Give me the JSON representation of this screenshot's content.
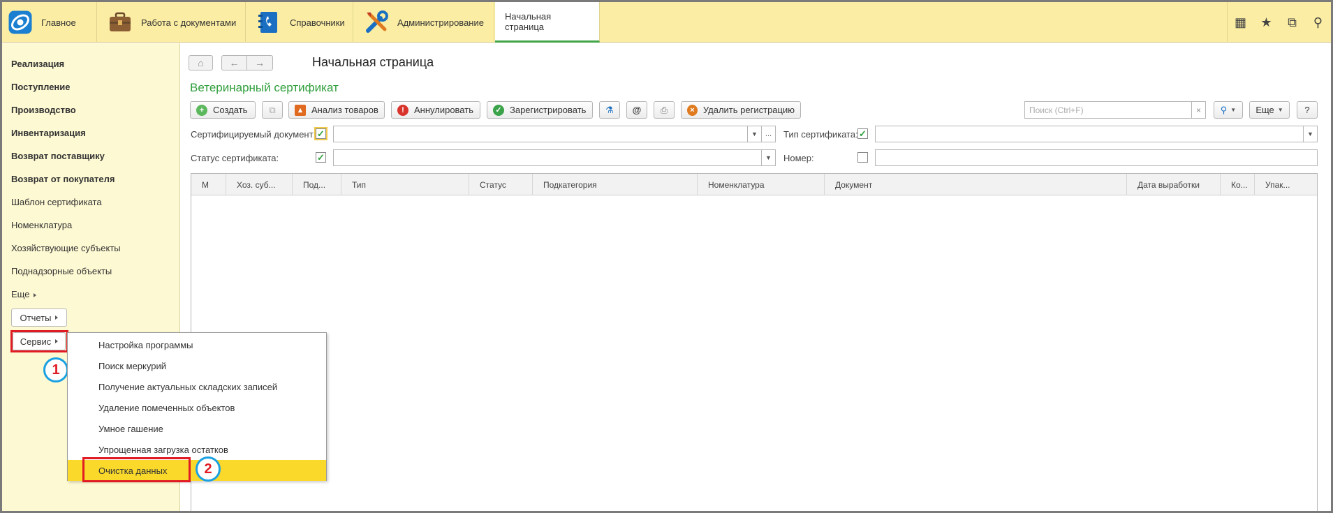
{
  "topbar": {
    "tabs": [
      {
        "label": "Главное",
        "icon": "app-logo-icon"
      },
      {
        "label": "Работа с документами",
        "icon": "briefcase-icon"
      },
      {
        "label": "Справочники",
        "icon": "address-book-icon"
      },
      {
        "label": "Администрирование",
        "icon": "tools-icon"
      },
      {
        "label": "Начальная страница",
        "icon": ""
      }
    ],
    "right_icons": {
      "apps": "▦",
      "favorites": "★",
      "history": "⧉",
      "search": "⚲"
    }
  },
  "sidebar": {
    "bold_items": [
      "Реализация",
      "Поступление",
      "Производство",
      "Инвентаризация",
      "Возврат поставщику",
      "Возврат от покупателя"
    ],
    "items": [
      "Шаблон сертификата",
      "Номенклатура",
      "Хозяйствующие субъекты",
      "Поднадзорные объекты",
      "Еще"
    ],
    "reports_button": "Отчеты",
    "service_button": "Сервис",
    "callout_1": "1"
  },
  "menu": {
    "items": [
      "Настройка программы",
      "Поиск меркурий",
      "Получение актуальных складских записей",
      "Удаление помеченных объектов",
      "Умное гашение",
      "Упрощенная загрузка остатков",
      "Очистка данных"
    ],
    "callout_2": "2"
  },
  "main": {
    "nav": {
      "home": "⌂",
      "back": "←",
      "forward": "→"
    },
    "page_title": "Начальная страница",
    "form_title": "Ветеринарный сертификат",
    "toolbar": {
      "create": "Создать",
      "copy": "⧉",
      "analyze": "Анализ товаров",
      "cancel": "Аннулировать",
      "register": "Зарегистрировать",
      "microscope": "⚗",
      "email": "@",
      "print": "⎙",
      "delete_reg": "Удалить регистрацию",
      "search_placeholder": "Поиск (Ctrl+F)",
      "search_clear": "×",
      "find": "⚲",
      "more": "Еще",
      "help": "?"
    },
    "filters": {
      "cert_doc_label": "Сертифицируемый документ:",
      "cert_type_label": "Тип сертификата:",
      "status_label": "Статус сертификата:",
      "number_label": "Номер:",
      "ellipsis": "..."
    },
    "table": {
      "columns": [
        "М",
        "Хоз. суб...",
        "Под...",
        "Тип",
        "Статус",
        "Подкатегория",
        "Номенклатура",
        "Документ",
        "Дата выработки",
        "Ко...",
        "Упак..."
      ]
    }
  }
}
